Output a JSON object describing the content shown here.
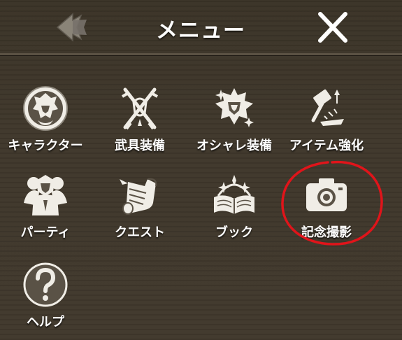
{
  "header": {
    "title": "メニュー",
    "back_icon": "back-arrow-icon",
    "close_icon": "close-icon"
  },
  "menu": {
    "items": [
      {
        "label": "キャラクター",
        "icon": "character-icon"
      },
      {
        "label": "武具装備",
        "icon": "weapon-equip-icon"
      },
      {
        "label": "オシャレ装備",
        "icon": "fashion-equip-icon"
      },
      {
        "label": "アイテム強化",
        "icon": "item-enhance-icon"
      },
      {
        "label": "パーティ",
        "icon": "party-icon"
      },
      {
        "label": "クエスト",
        "icon": "quest-scroll-icon"
      },
      {
        "label": "ブック",
        "icon": "book-icon"
      },
      {
        "label": "記念撮影",
        "icon": "camera-icon"
      },
      {
        "label": "ヘルプ",
        "icon": "help-icon"
      }
    ]
  },
  "colors": {
    "background": "#3d3529",
    "text": "#ffffff",
    "icon": "#f0ede6",
    "highlight": "#e0141a"
  }
}
